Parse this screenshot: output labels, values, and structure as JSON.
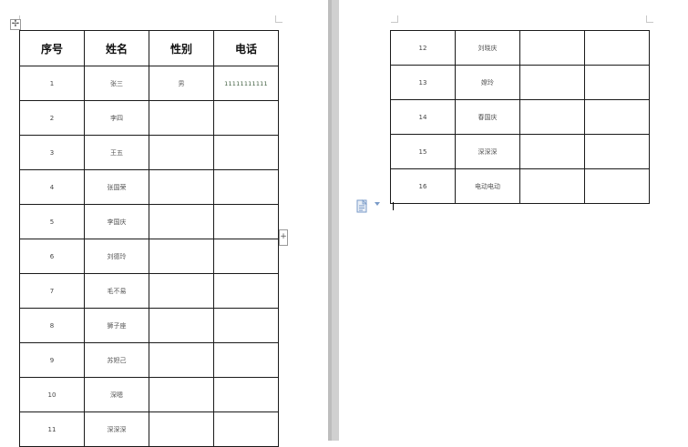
{
  "table": {
    "headers": [
      "序号",
      "姓名",
      "性别",
      "电话"
    ]
  },
  "rows_left": [
    {
      "no": "1",
      "name": "张三",
      "gender": "男",
      "phone": "11111111111"
    },
    {
      "no": "2",
      "name": "李四",
      "gender": "",
      "phone": ""
    },
    {
      "no": "3",
      "name": "王五",
      "gender": "",
      "phone": ""
    },
    {
      "no": "4",
      "name": "张国荣",
      "gender": "",
      "phone": ""
    },
    {
      "no": "5",
      "name": "李国庆",
      "gender": "",
      "phone": ""
    },
    {
      "no": "6",
      "name": "刘德玲",
      "gender": "",
      "phone": ""
    },
    {
      "no": "7",
      "name": "毛不易",
      "gender": "",
      "phone": ""
    },
    {
      "no": "8",
      "name": "狮子座",
      "gender": "",
      "phone": ""
    },
    {
      "no": "9",
      "name": "苏妲己",
      "gender": "",
      "phone": ""
    },
    {
      "no": "10",
      "name": "深嗯",
      "gender": "",
      "phone": ""
    },
    {
      "no": "11",
      "name": "深深深",
      "gender": "",
      "phone": ""
    }
  ],
  "rows_right": [
    {
      "no": "12",
      "name": "刘晓庆",
      "gender": "",
      "phone": ""
    },
    {
      "no": "13",
      "name": "嫦玲",
      "gender": "",
      "phone": ""
    },
    {
      "no": "14",
      "name": "春国庆",
      "gender": "",
      "phone": ""
    },
    {
      "no": "15",
      "name": "深深深",
      "gender": "",
      "phone": ""
    },
    {
      "no": "16",
      "name": "电动电动",
      "gender": "",
      "phone": ""
    }
  ],
  "icons": {
    "table_move": "move-cross-icon",
    "table_add_column": "plus-icon",
    "paste_options": "paste-options-icon"
  },
  "colors": {
    "border": "#1a1a1a",
    "gutter": "#d0d0d0",
    "phone_text": "#3d5c3d"
  }
}
